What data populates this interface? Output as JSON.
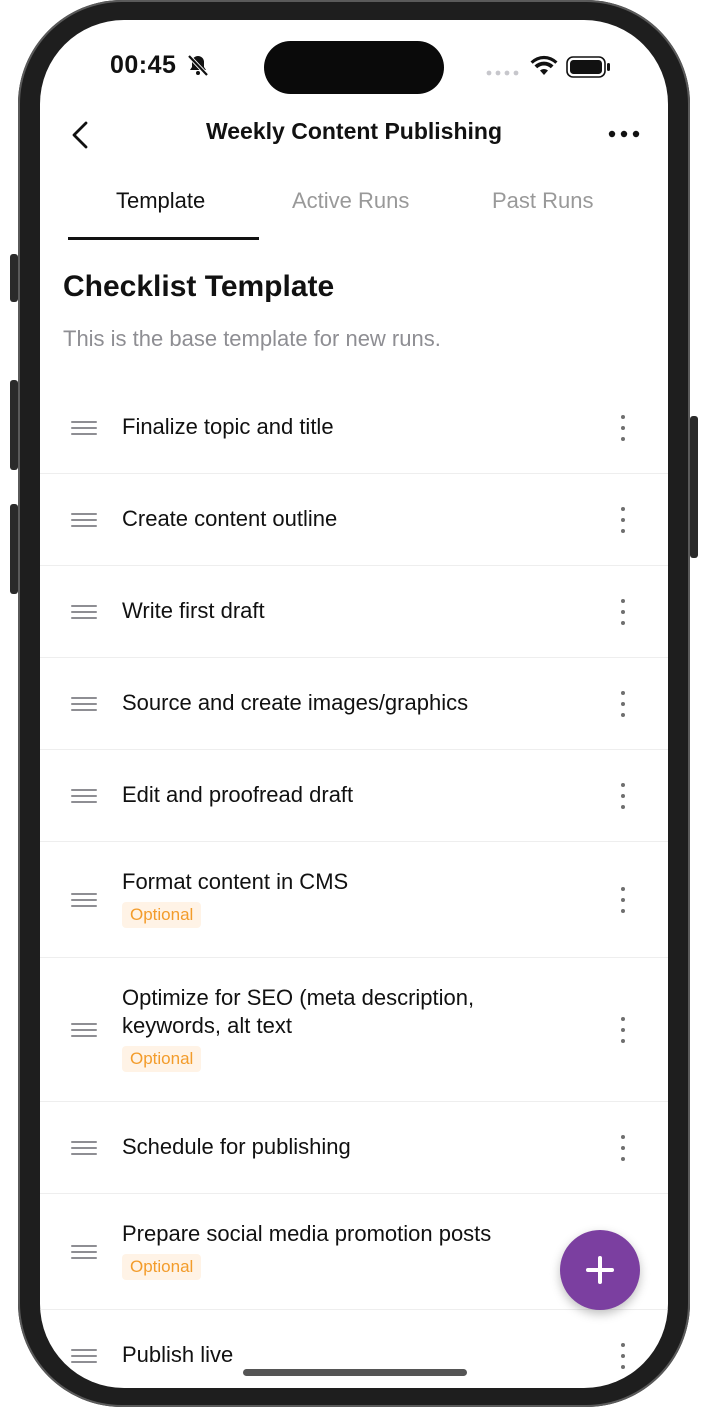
{
  "status_bar": {
    "time": "00:45"
  },
  "nav": {
    "title": "Weekly Content Publishing"
  },
  "tabs": [
    {
      "label": "Template",
      "active": true
    },
    {
      "label": "Active Runs",
      "active": false
    },
    {
      "label": "Past Runs",
      "active": false
    }
  ],
  "header": {
    "title": "Checklist Template",
    "subtitle": "This is the base template for new runs."
  },
  "items": [
    {
      "label": "Finalize topic and title",
      "badge": ""
    },
    {
      "label": "Create content outline",
      "badge": ""
    },
    {
      "label": "Write first draft",
      "badge": ""
    },
    {
      "label": "Source and create images/graphics",
      "badge": ""
    },
    {
      "label": "Edit and proofread draft",
      "badge": ""
    },
    {
      "label": "Format content in CMS",
      "badge": "Optional"
    },
    {
      "label": "Optimize for SEO (meta description, keywords, alt text",
      "badge": "Optional"
    },
    {
      "label": "Schedule for publishing",
      "badge": ""
    },
    {
      "label": "Prepare social media promotion posts",
      "badge": "Optional"
    },
    {
      "label": "Publish live",
      "badge": ""
    }
  ],
  "colors": {
    "accent": "#7b3fa0",
    "badge_text": "#f39c2b",
    "badge_bg": "#fff3e6"
  },
  "icons": {
    "back": "chevron-left-icon",
    "more": "ellipsis-icon",
    "drag": "drag-handle-icon",
    "item_menu": "vertical-ellipsis-icon",
    "add": "plus-icon"
  }
}
